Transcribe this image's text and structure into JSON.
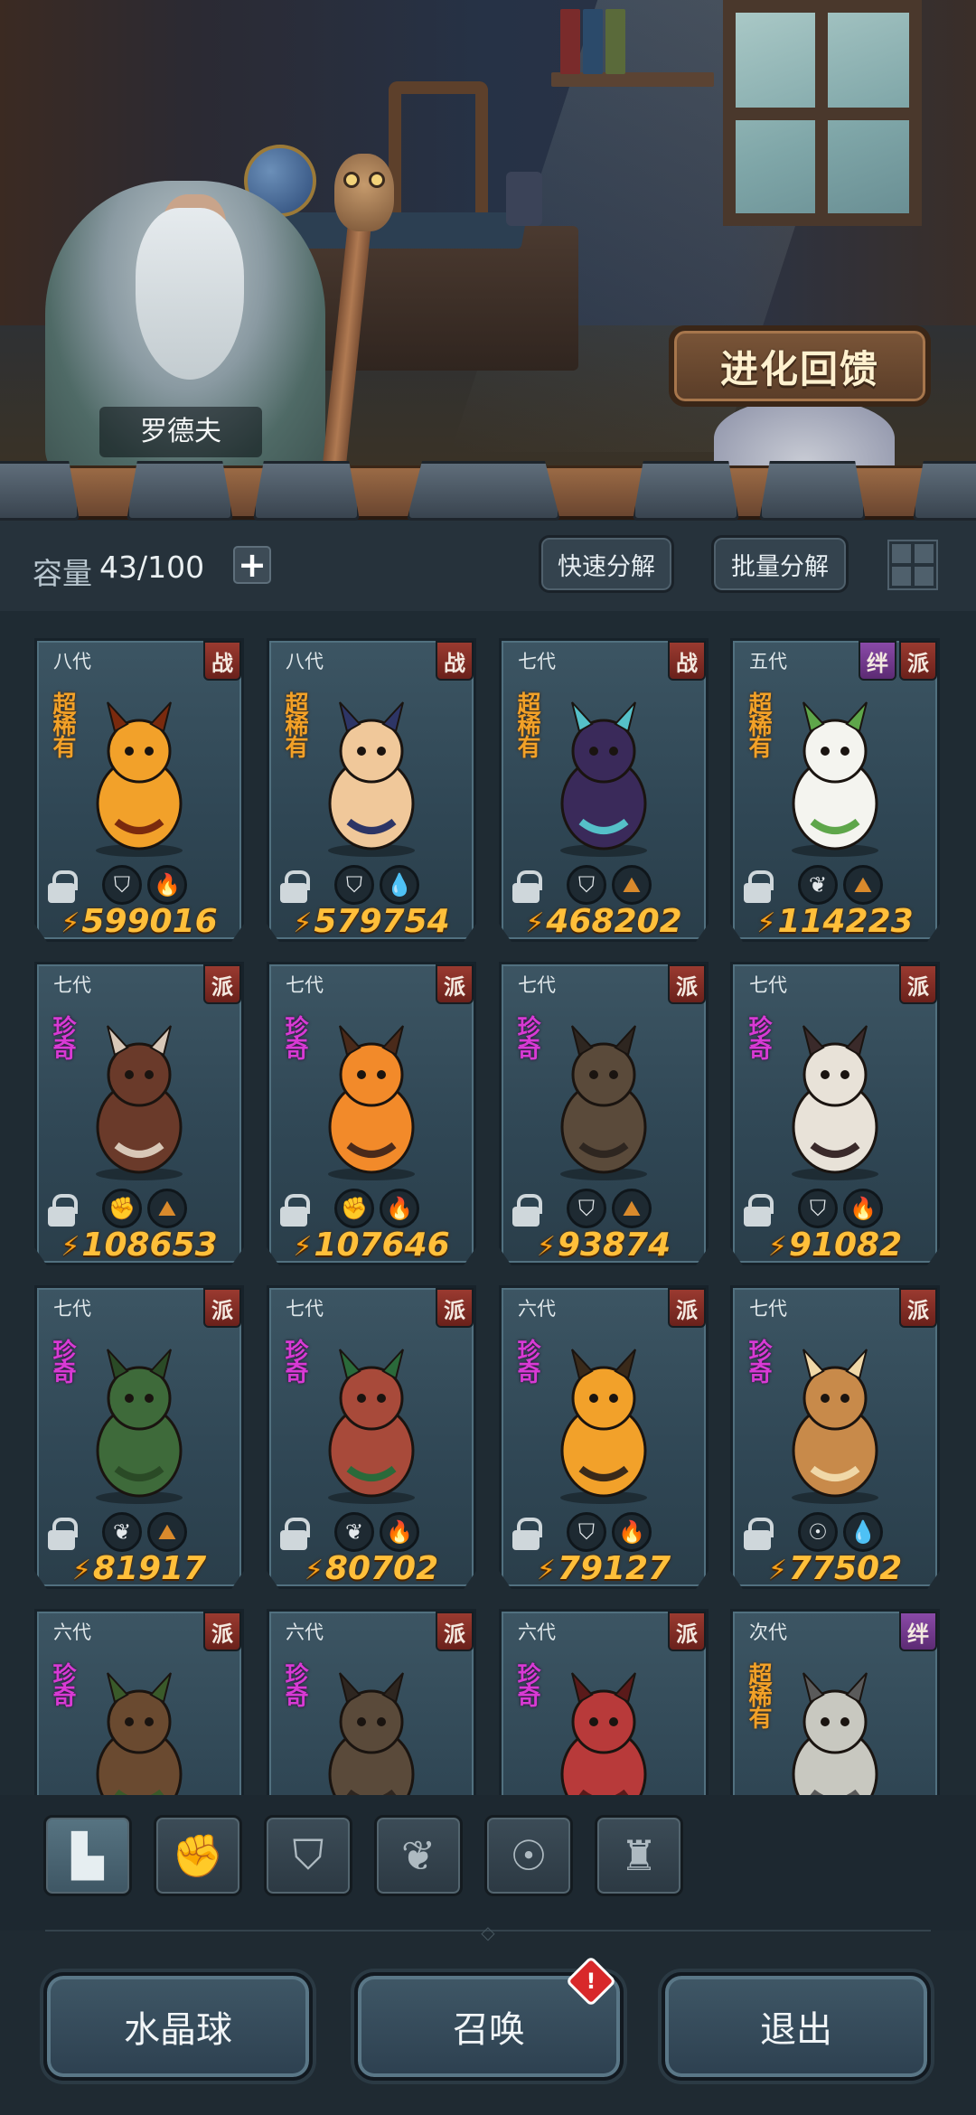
{
  "npc": {
    "name": "罗德夫"
  },
  "evolution_button": "进化回馈",
  "capacity": {
    "label": "容量",
    "value": "43/100",
    "add_icon": "plus-icon"
  },
  "toolbar": {
    "quick_decompose": "快速分解",
    "batch_decompose": "批量分解",
    "view_toggle_icon": "grid-view-icon"
  },
  "cards": [
    {
      "gen": "八代",
      "tags": [
        "战"
      ],
      "rarity": "超稀有",
      "elements": [
        "shield-icon",
        "fire-icon"
      ],
      "power": "599016"
    },
    {
      "gen": "八代",
      "tags": [
        "战"
      ],
      "rarity": "超稀有",
      "elements": [
        "shield-icon",
        "water-icon"
      ],
      "power": "579754"
    },
    {
      "gen": "七代",
      "tags": [
        "战"
      ],
      "rarity": "超稀有",
      "elements": [
        "shield-icon",
        "earth-icon"
      ],
      "power": "468202"
    },
    {
      "gen": "五代",
      "tags": [
        "绊",
        "派"
      ],
      "rarity": "超稀有",
      "elements": [
        "leaf-icon",
        "earth-icon"
      ],
      "power": "114223"
    },
    {
      "gen": "七代",
      "tags": [
        "派"
      ],
      "rarity": "珍奇",
      "elements": [
        "fist-icon",
        "earth-icon"
      ],
      "power": "108653"
    },
    {
      "gen": "七代",
      "tags": [
        "派"
      ],
      "rarity": "珍奇",
      "elements": [
        "fist-icon",
        "fire-icon"
      ],
      "power": "107646"
    },
    {
      "gen": "七代",
      "tags": [
        "派"
      ],
      "rarity": "珍奇",
      "elements": [
        "shield-icon",
        "earth-icon"
      ],
      "power": "93874"
    },
    {
      "gen": "七代",
      "tags": [
        "派"
      ],
      "rarity": "珍奇",
      "elements": [
        "shield-icon",
        "fire-icon"
      ],
      "power": "91082"
    },
    {
      "gen": "七代",
      "tags": [
        "派"
      ],
      "rarity": "珍奇",
      "elements": [
        "leaf-icon",
        "earth-icon"
      ],
      "power": "81917"
    },
    {
      "gen": "七代",
      "tags": [
        "派"
      ],
      "rarity": "珍奇",
      "elements": [
        "leaf-icon",
        "fire-icon"
      ],
      "power": "80702"
    },
    {
      "gen": "六代",
      "tags": [
        "派"
      ],
      "rarity": "珍奇",
      "elements": [
        "shield-icon",
        "fire-icon"
      ],
      "power": "79127"
    },
    {
      "gen": "七代",
      "tags": [
        "派"
      ],
      "rarity": "珍奇",
      "elements": [
        "alien-icon",
        "water-icon"
      ],
      "power": "77502"
    },
    {
      "gen": "六代",
      "tags": [
        "派"
      ],
      "rarity": "珍奇",
      "elements": [],
      "power": ""
    },
    {
      "gen": "六代",
      "tags": [
        "派"
      ],
      "rarity": "珍奇",
      "elements": [],
      "power": ""
    },
    {
      "gen": "六代",
      "tags": [
        "派"
      ],
      "rarity": "珍奇",
      "elements": [],
      "power": ""
    },
    {
      "gen": "次代",
      "tags": [
        "绊"
      ],
      "rarity": "超稀有",
      "elements": [],
      "power": ""
    }
  ],
  "filters": [
    "all-icon",
    "fist-icon",
    "shield-icon",
    "leaf-icon",
    "alien-icon",
    "tower-icon"
  ],
  "bottom": {
    "crystal_ball": "水晶球",
    "summon": "召唤",
    "summon_alert": "!",
    "exit": "退出"
  },
  "colors": {
    "power_text": "#ffbf3a",
    "super_rare": "#f2a128",
    "rare": "#d83ad4",
    "war_tag": "#9a3a30",
    "bond_tag": "#8a4aa8"
  }
}
